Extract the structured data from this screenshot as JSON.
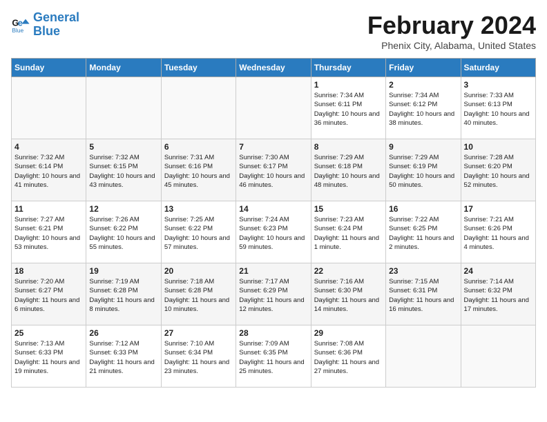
{
  "header": {
    "logo_line1": "General",
    "logo_line2": "Blue",
    "month": "February 2024",
    "location": "Phenix City, Alabama, United States"
  },
  "weekdays": [
    "Sunday",
    "Monday",
    "Tuesday",
    "Wednesday",
    "Thursday",
    "Friday",
    "Saturday"
  ],
  "weeks": [
    [
      {
        "day": "",
        "empty": true
      },
      {
        "day": "",
        "empty": true
      },
      {
        "day": "",
        "empty": true
      },
      {
        "day": "",
        "empty": true
      },
      {
        "day": "1",
        "sunrise": "7:34 AM",
        "sunset": "6:11 PM",
        "daylight": "10 hours and 36 minutes."
      },
      {
        "day": "2",
        "sunrise": "7:34 AM",
        "sunset": "6:12 PM",
        "daylight": "10 hours and 38 minutes."
      },
      {
        "day": "3",
        "sunrise": "7:33 AM",
        "sunset": "6:13 PM",
        "daylight": "10 hours and 40 minutes."
      }
    ],
    [
      {
        "day": "4",
        "sunrise": "7:32 AM",
        "sunset": "6:14 PM",
        "daylight": "10 hours and 41 minutes."
      },
      {
        "day": "5",
        "sunrise": "7:32 AM",
        "sunset": "6:15 PM",
        "daylight": "10 hours and 43 minutes."
      },
      {
        "day": "6",
        "sunrise": "7:31 AM",
        "sunset": "6:16 PM",
        "daylight": "10 hours and 45 minutes."
      },
      {
        "day": "7",
        "sunrise": "7:30 AM",
        "sunset": "6:17 PM",
        "daylight": "10 hours and 46 minutes."
      },
      {
        "day": "8",
        "sunrise": "7:29 AM",
        "sunset": "6:18 PM",
        "daylight": "10 hours and 48 minutes."
      },
      {
        "day": "9",
        "sunrise": "7:29 AM",
        "sunset": "6:19 PM",
        "daylight": "10 hours and 50 minutes."
      },
      {
        "day": "10",
        "sunrise": "7:28 AM",
        "sunset": "6:20 PM",
        "daylight": "10 hours and 52 minutes."
      }
    ],
    [
      {
        "day": "11",
        "sunrise": "7:27 AM",
        "sunset": "6:21 PM",
        "daylight": "10 hours and 53 minutes."
      },
      {
        "day": "12",
        "sunrise": "7:26 AM",
        "sunset": "6:22 PM",
        "daylight": "10 hours and 55 minutes."
      },
      {
        "day": "13",
        "sunrise": "7:25 AM",
        "sunset": "6:22 PM",
        "daylight": "10 hours and 57 minutes."
      },
      {
        "day": "14",
        "sunrise": "7:24 AM",
        "sunset": "6:23 PM",
        "daylight": "10 hours and 59 minutes."
      },
      {
        "day": "15",
        "sunrise": "7:23 AM",
        "sunset": "6:24 PM",
        "daylight": "11 hours and 1 minute."
      },
      {
        "day": "16",
        "sunrise": "7:22 AM",
        "sunset": "6:25 PM",
        "daylight": "11 hours and 2 minutes."
      },
      {
        "day": "17",
        "sunrise": "7:21 AM",
        "sunset": "6:26 PM",
        "daylight": "11 hours and 4 minutes."
      }
    ],
    [
      {
        "day": "18",
        "sunrise": "7:20 AM",
        "sunset": "6:27 PM",
        "daylight": "11 hours and 6 minutes."
      },
      {
        "day": "19",
        "sunrise": "7:19 AM",
        "sunset": "6:28 PM",
        "daylight": "11 hours and 8 minutes."
      },
      {
        "day": "20",
        "sunrise": "7:18 AM",
        "sunset": "6:28 PM",
        "daylight": "11 hours and 10 minutes."
      },
      {
        "day": "21",
        "sunrise": "7:17 AM",
        "sunset": "6:29 PM",
        "daylight": "11 hours and 12 minutes."
      },
      {
        "day": "22",
        "sunrise": "7:16 AM",
        "sunset": "6:30 PM",
        "daylight": "11 hours and 14 minutes."
      },
      {
        "day": "23",
        "sunrise": "7:15 AM",
        "sunset": "6:31 PM",
        "daylight": "11 hours and 16 minutes."
      },
      {
        "day": "24",
        "sunrise": "7:14 AM",
        "sunset": "6:32 PM",
        "daylight": "11 hours and 17 minutes."
      }
    ],
    [
      {
        "day": "25",
        "sunrise": "7:13 AM",
        "sunset": "6:33 PM",
        "daylight": "11 hours and 19 minutes."
      },
      {
        "day": "26",
        "sunrise": "7:12 AM",
        "sunset": "6:33 PM",
        "daylight": "11 hours and 21 minutes."
      },
      {
        "day": "27",
        "sunrise": "7:10 AM",
        "sunset": "6:34 PM",
        "daylight": "11 hours and 23 minutes."
      },
      {
        "day": "28",
        "sunrise": "7:09 AM",
        "sunset": "6:35 PM",
        "daylight": "11 hours and 25 minutes."
      },
      {
        "day": "29",
        "sunrise": "7:08 AM",
        "sunset": "6:36 PM",
        "daylight": "11 hours and 27 minutes."
      },
      {
        "day": "",
        "empty": true
      },
      {
        "day": "",
        "empty": true
      }
    ]
  ],
  "labels": {
    "sunrise": "Sunrise:",
    "sunset": "Sunset:",
    "daylight": "Daylight:"
  }
}
